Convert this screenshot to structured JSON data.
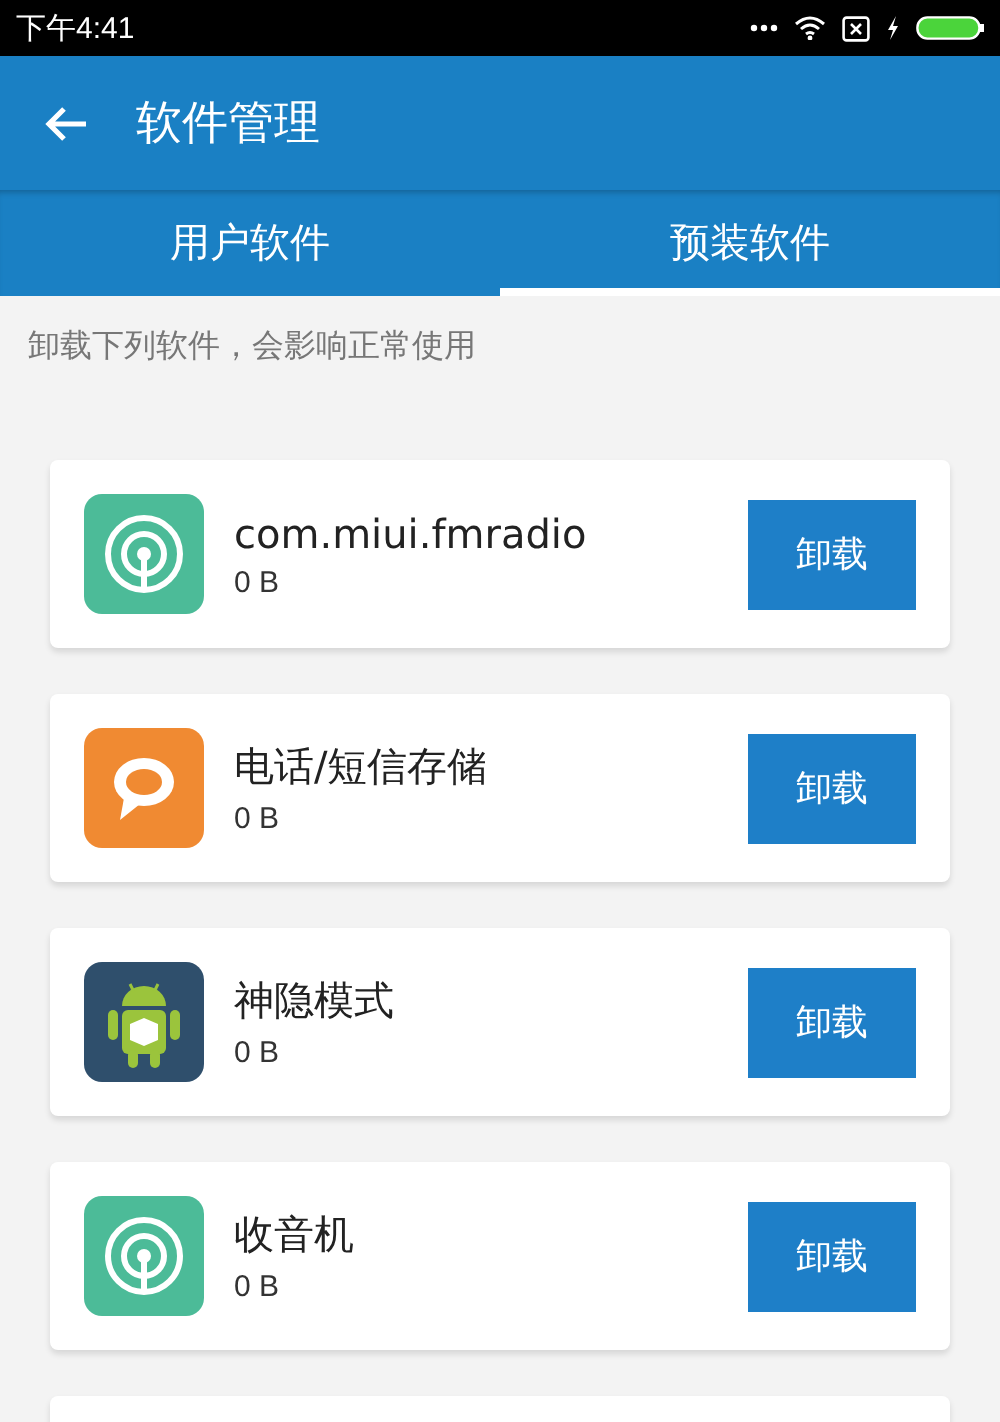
{
  "status_bar": {
    "time": "下午4:41"
  },
  "app_bar": {
    "title": "软件管理"
  },
  "tabs": [
    {
      "label": "用户软件",
      "selected": false
    },
    {
      "label": "预装软件",
      "selected": true
    }
  ],
  "notice": "卸载下列软件，会影响正常使用",
  "apps": [
    {
      "kind": "radio",
      "name": "com.miui.fmradio",
      "size": "0 B",
      "button": "卸载"
    },
    {
      "kind": "chat",
      "name": "电话/短信存储",
      "size": "0 B",
      "button": "卸载"
    },
    {
      "kind": "android",
      "name": "神隐模式",
      "size": "0 B",
      "button": "卸载"
    },
    {
      "kind": "radio",
      "name": "收音机",
      "size": "0 B",
      "button": "卸载"
    }
  ]
}
